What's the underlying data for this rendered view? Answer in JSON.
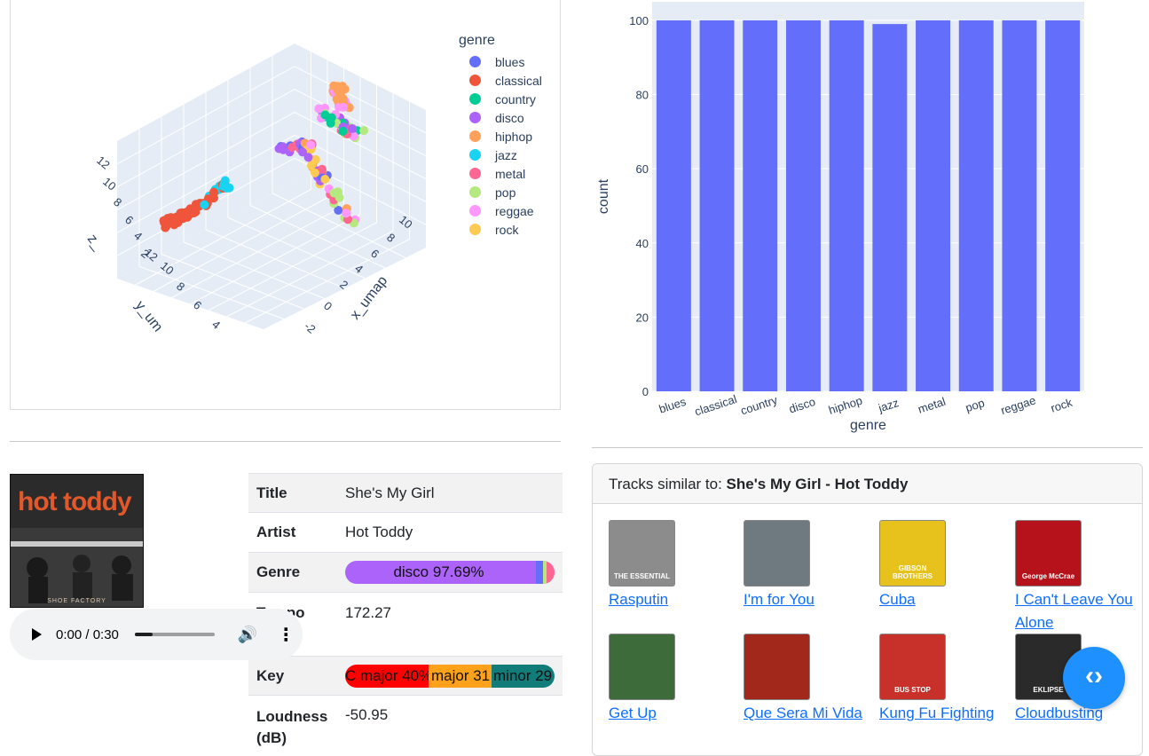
{
  "scatter3d": {
    "legend_title": "genre",
    "legend": [
      {
        "label": "blues",
        "color": "#636efa"
      },
      {
        "label": "classical",
        "color": "#ef553b"
      },
      {
        "label": "country",
        "color": "#00cc96"
      },
      {
        "label": "disco",
        "color": "#ab63fa"
      },
      {
        "label": "hiphop",
        "color": "#ffa15a"
      },
      {
        "label": "jazz",
        "color": "#19d3f3"
      },
      {
        "label": "metal",
        "color": "#ff6692"
      },
      {
        "label": "pop",
        "color": "#b6e880"
      },
      {
        "label": "reggae",
        "color": "#ff97ff"
      },
      {
        "label": "rock",
        "color": "#fecb52"
      }
    ],
    "x_axis_label": "x_umap",
    "y_axis_label": "y_um",
    "z_axis_label": "z_",
    "x_ticks": [
      "10",
      "8",
      "6",
      "4",
      "2",
      "0",
      "-2"
    ],
    "y_ticks": [
      "12",
      "10",
      "8",
      "6",
      "4"
    ],
    "z_ticks": [
      "12",
      "10",
      "8",
      "6",
      "4",
      "2"
    ]
  },
  "chart_data": {
    "type": "bar",
    "categories": [
      "blues",
      "classical",
      "country",
      "disco",
      "hiphop",
      "jazz",
      "metal",
      "pop",
      "reggae",
      "rock"
    ],
    "values": [
      100,
      100,
      100,
      100,
      100,
      99,
      100,
      100,
      100,
      100
    ],
    "xlabel": "genre",
    "ylabel": "count",
    "yticks": [
      0,
      20,
      40,
      60,
      80,
      100
    ],
    "ylim": [
      0,
      105
    ],
    "bar_color": "#636efa",
    "plot_bg": "#e5ecf6",
    "grid": true
  },
  "track": {
    "cover_title": "hot toddy",
    "cover_subtitle": "SHOE FACTORY",
    "rows": {
      "title_label": "Title",
      "title_value": "She's My Girl",
      "artist_label": "Artist",
      "artist_value": "Hot Toddy",
      "genre_label": "Genre",
      "genre_value": "disco 97.69%",
      "tempo_label": "Tempo",
      "tempo_value": "172.27",
      "key_label": "Key",
      "loudness_label": "Loudness (dB)",
      "loudness_value": "-50.95"
    },
    "genre_segments": [
      {
        "label": "disco 97.69%",
        "fraction": 0.9769,
        "color": "#ab63fa"
      },
      {
        "label": "blues",
        "color": "#636efa"
      },
      {
        "label": "pop",
        "color": "#b6e880"
      },
      {
        "label": "metal",
        "color": "#ff6692"
      }
    ],
    "key_segments": [
      {
        "label": "C major 40%",
        "color": "#ff0000"
      },
      {
        "label": "major 31",
        "color": "#ffa11a"
      },
      {
        "label": "minor 29",
        "color": "#127c78"
      }
    ]
  },
  "player": {
    "time": "0:00 / 0:30",
    "progress_fraction": 0.22
  },
  "similar": {
    "heading_prefix": "Tracks similar to: ",
    "heading_track": "She's My Girl - Hot Toddy",
    "tracks": [
      {
        "title": "Rasputin",
        "thumb_text": "THE ESSENTIAL",
        "thumb_bg": "#8c8c8c"
      },
      {
        "title": "I'm for You",
        "thumb_text": "",
        "thumb_bg": "#6f7a80"
      },
      {
        "title": "Cuba",
        "thumb_text": "GIBSON BROTHERS",
        "thumb_bg": "#e8c21c"
      },
      {
        "title": "I Can't Leave You Alone",
        "thumb_text": "George McCrae",
        "thumb_bg": "#b5121b"
      },
      {
        "title": "Get Up",
        "thumb_text": "",
        "thumb_bg": "#3e6b3a"
      },
      {
        "title": "Que Sera Mi Vida",
        "thumb_text": "",
        "thumb_bg": "#a1281b"
      },
      {
        "title": "Kung Fu Fighting",
        "thumb_text": "BUS STOP",
        "thumb_bg": "#c8302a"
      },
      {
        "title": "Cloudbusting",
        "thumb_text": "EKLIPSE",
        "thumb_bg": "#2a2a2a"
      }
    ]
  },
  "fab": {
    "icon": "code-icon"
  }
}
